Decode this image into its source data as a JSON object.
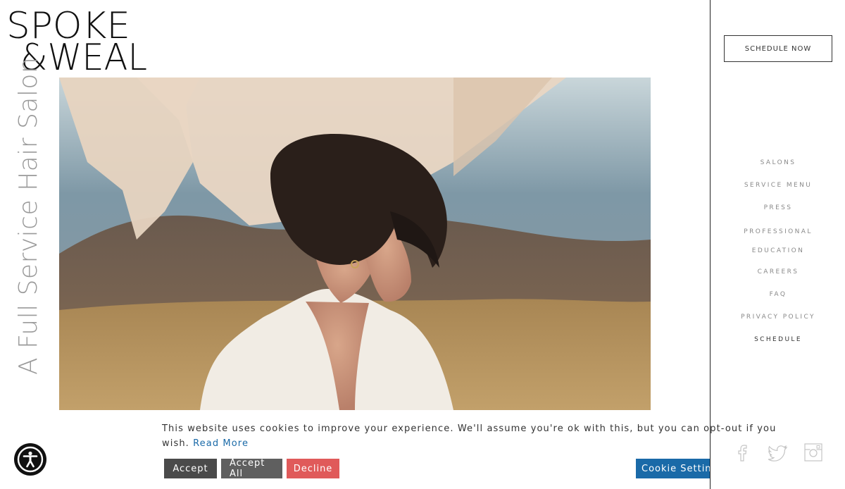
{
  "brand": {
    "logo_line1": "SPOKE",
    "logo_line2": "&WEAL",
    "tagline": "A Full Service Hair Salon"
  },
  "header": {
    "schedule_now": "SCHEDULE NOW"
  },
  "nav": {
    "items": [
      {
        "label": "SALONS"
      },
      {
        "label": "SERVICE MENU"
      },
      {
        "label": "PRESS"
      },
      {
        "label": "PROFESSIONAL EDUCATION"
      },
      {
        "label": "CAREERS"
      },
      {
        "label": "FAQ"
      },
      {
        "label": "PRIVACY POLICY"
      },
      {
        "label": "SCHEDULE"
      }
    ]
  },
  "social": {
    "icons": [
      "facebook-icon",
      "twitter-icon",
      "instagram-icon"
    ]
  },
  "cookie_banner": {
    "message_line1": "This website uses cookies to improve your experience. We'll assume you're ok with this, but you can opt-out if you",
    "message_line2": "wish.",
    "read_more": "Read More",
    "accept": "Accept",
    "accept_all": "Accept All",
    "decline": "Decline",
    "settings": "Cookie Settings"
  },
  "colors": {
    "accent_link": "#1a6aa8",
    "decline": "#e05a5a",
    "nav_text": "#8a8a8a"
  }
}
